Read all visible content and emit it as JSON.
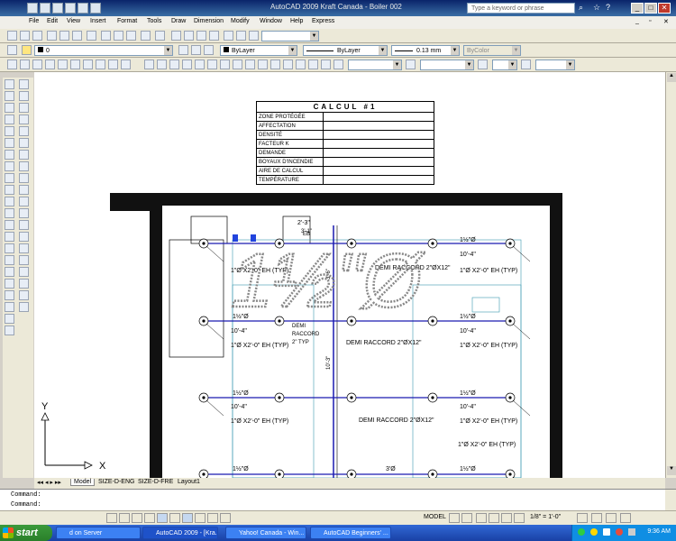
{
  "window": {
    "title": "AutoCAD 2009 Kraft Canada - Boiler 002",
    "search_placeholder": "Type a keyword or phrase"
  },
  "menu": [
    "File",
    "Edit",
    "View",
    "Insert",
    "Format",
    "Tools",
    "Draw",
    "Dimension",
    "Modify",
    "Window",
    "Help",
    "Express"
  ],
  "layers": {
    "current_layer": "0",
    "color": "ByLayer",
    "linetype": "ByLayer",
    "lineweight": "0.13 mm",
    "plotstyle": "ByColor"
  },
  "calc_table": {
    "title": "CALCUL #1",
    "rows": [
      "ZONE PROTÉGÉE",
      "AFFECTATION",
      "DENSITÉ",
      "FACTEUR K",
      "DEMANDE",
      "BOYAUX D'INCENDIE",
      "AIRE DE CALCUL",
      "TEMPÉRATURE"
    ]
  },
  "drawing": {
    "watermark": "1½\"Ø",
    "labels": {
      "dim_2_3": "2'-3\"",
      "dim_3_1": "3'-1\"",
      "eb": "EB",
      "diam_1_5": "1½\"Ø",
      "dim_10_4": "10'-4\"",
      "pipe_eh": "1\"Ø X2'-0\" EH (TYP)",
      "demi_raccord_2": "DEMI RACCORD 2\"ØX12\"",
      "demi_raccord_word": "DEMI",
      "raccord": "RACCORD",
      "typ2": "2\" TYP",
      "dim_3_0": "3'Ø",
      "vert_dim": "10'-3\"",
      "vert_dim2": "3'-6\""
    }
  },
  "ucs": {
    "x": "X",
    "y": "Y"
  },
  "tabs": [
    "Model",
    "SIZE-D-ENG",
    "SIZE-D-FRE",
    "Layout1"
  ],
  "command": {
    "line1": "Command:",
    "line2": "Command:"
  },
  "status": {
    "model": "MODEL",
    "scale": "1/8\" = 1'-0\""
  },
  "taskbar": {
    "start": "start",
    "tasks": [
      "d on Server",
      "AutoCAD 2009 - [Kra...",
      "Yahoo! Canada - Win...",
      "AutoCAD Beginners' ..."
    ],
    "clock": "9:36 AM"
  },
  "colors": {
    "title_bar": "#0a246a",
    "taskbar": "#245edb",
    "start": "#3c9a3c",
    "drawing_line": "#1a1ab0",
    "wall": "#111111"
  }
}
